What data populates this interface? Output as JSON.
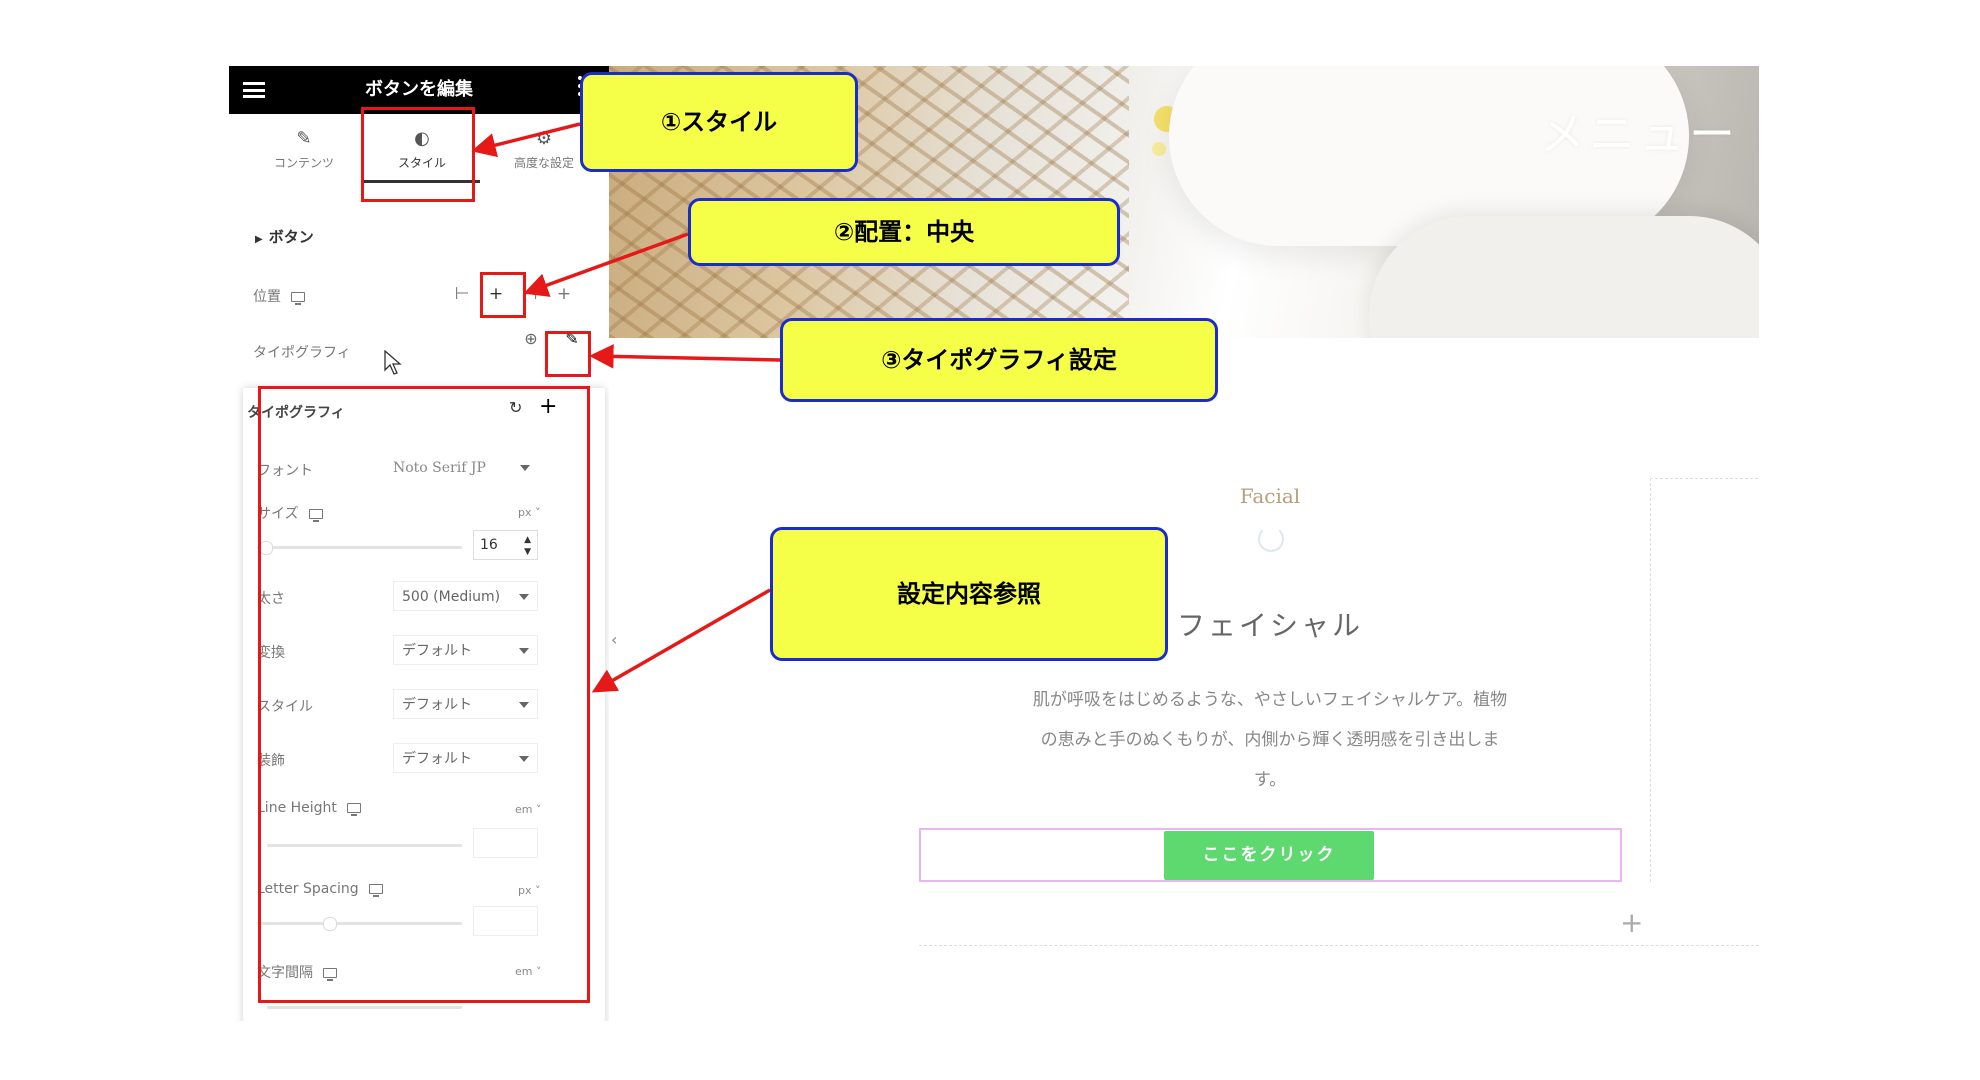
{
  "editor": {
    "title": "ボタンを編集",
    "tabs": [
      {
        "label": "コンテンツ",
        "icon": "pencil-icon"
      },
      {
        "label": "スタイル",
        "icon": "contrast-icon"
      },
      {
        "label": "高度な設定",
        "icon": "gear-icon"
      }
    ],
    "section": "ボタン",
    "position_label": "位置",
    "typography_label": "タイポグラフィ",
    "popover": {
      "title": "タイポグラフィ",
      "font_label": "フォント",
      "font_value": "Noto Serif JP",
      "size_label": "サイズ",
      "size_unit": "px",
      "size_value": "16",
      "weight_label": "太さ",
      "weight_value": "500 (Medium)",
      "transform_label": "変換",
      "transform_value": "デフォルト",
      "style_label": "スタイル",
      "style_value": "デフォルト",
      "decoration_label": "装飾",
      "decoration_value": "デフォルト",
      "line_height_label": "Line Height",
      "line_height_unit": "em",
      "letter_spacing_label": "Letter Spacing",
      "letter_spacing_unit": "px",
      "word_spacing_label": "文字間隔",
      "word_spacing_unit": "em"
    }
  },
  "page": {
    "hero_title": "メニュー",
    "subtitle": "Facial",
    "heading": "フェイシャル",
    "body_lines": [
      "肌が呼吸をはじめるような、やさしいフェイシャルケア。植物",
      "の恵みと手のぬくもりが、内側から輝く透明感を引き出しま",
      "す。"
    ],
    "button_label": "ここをクリック"
  },
  "callouts": {
    "c1": "①スタイル",
    "c2": "②配置：中央",
    "c3": "③タイポグラフィ設定",
    "c4": "設定内容参照"
  },
  "colors": {
    "annotation_red": "#e61919",
    "callout_fill": "#f5ff47",
    "callout_border": "#1a2ccc",
    "button_green": "#5dd96f",
    "button_outline": "#e8b7ef"
  }
}
